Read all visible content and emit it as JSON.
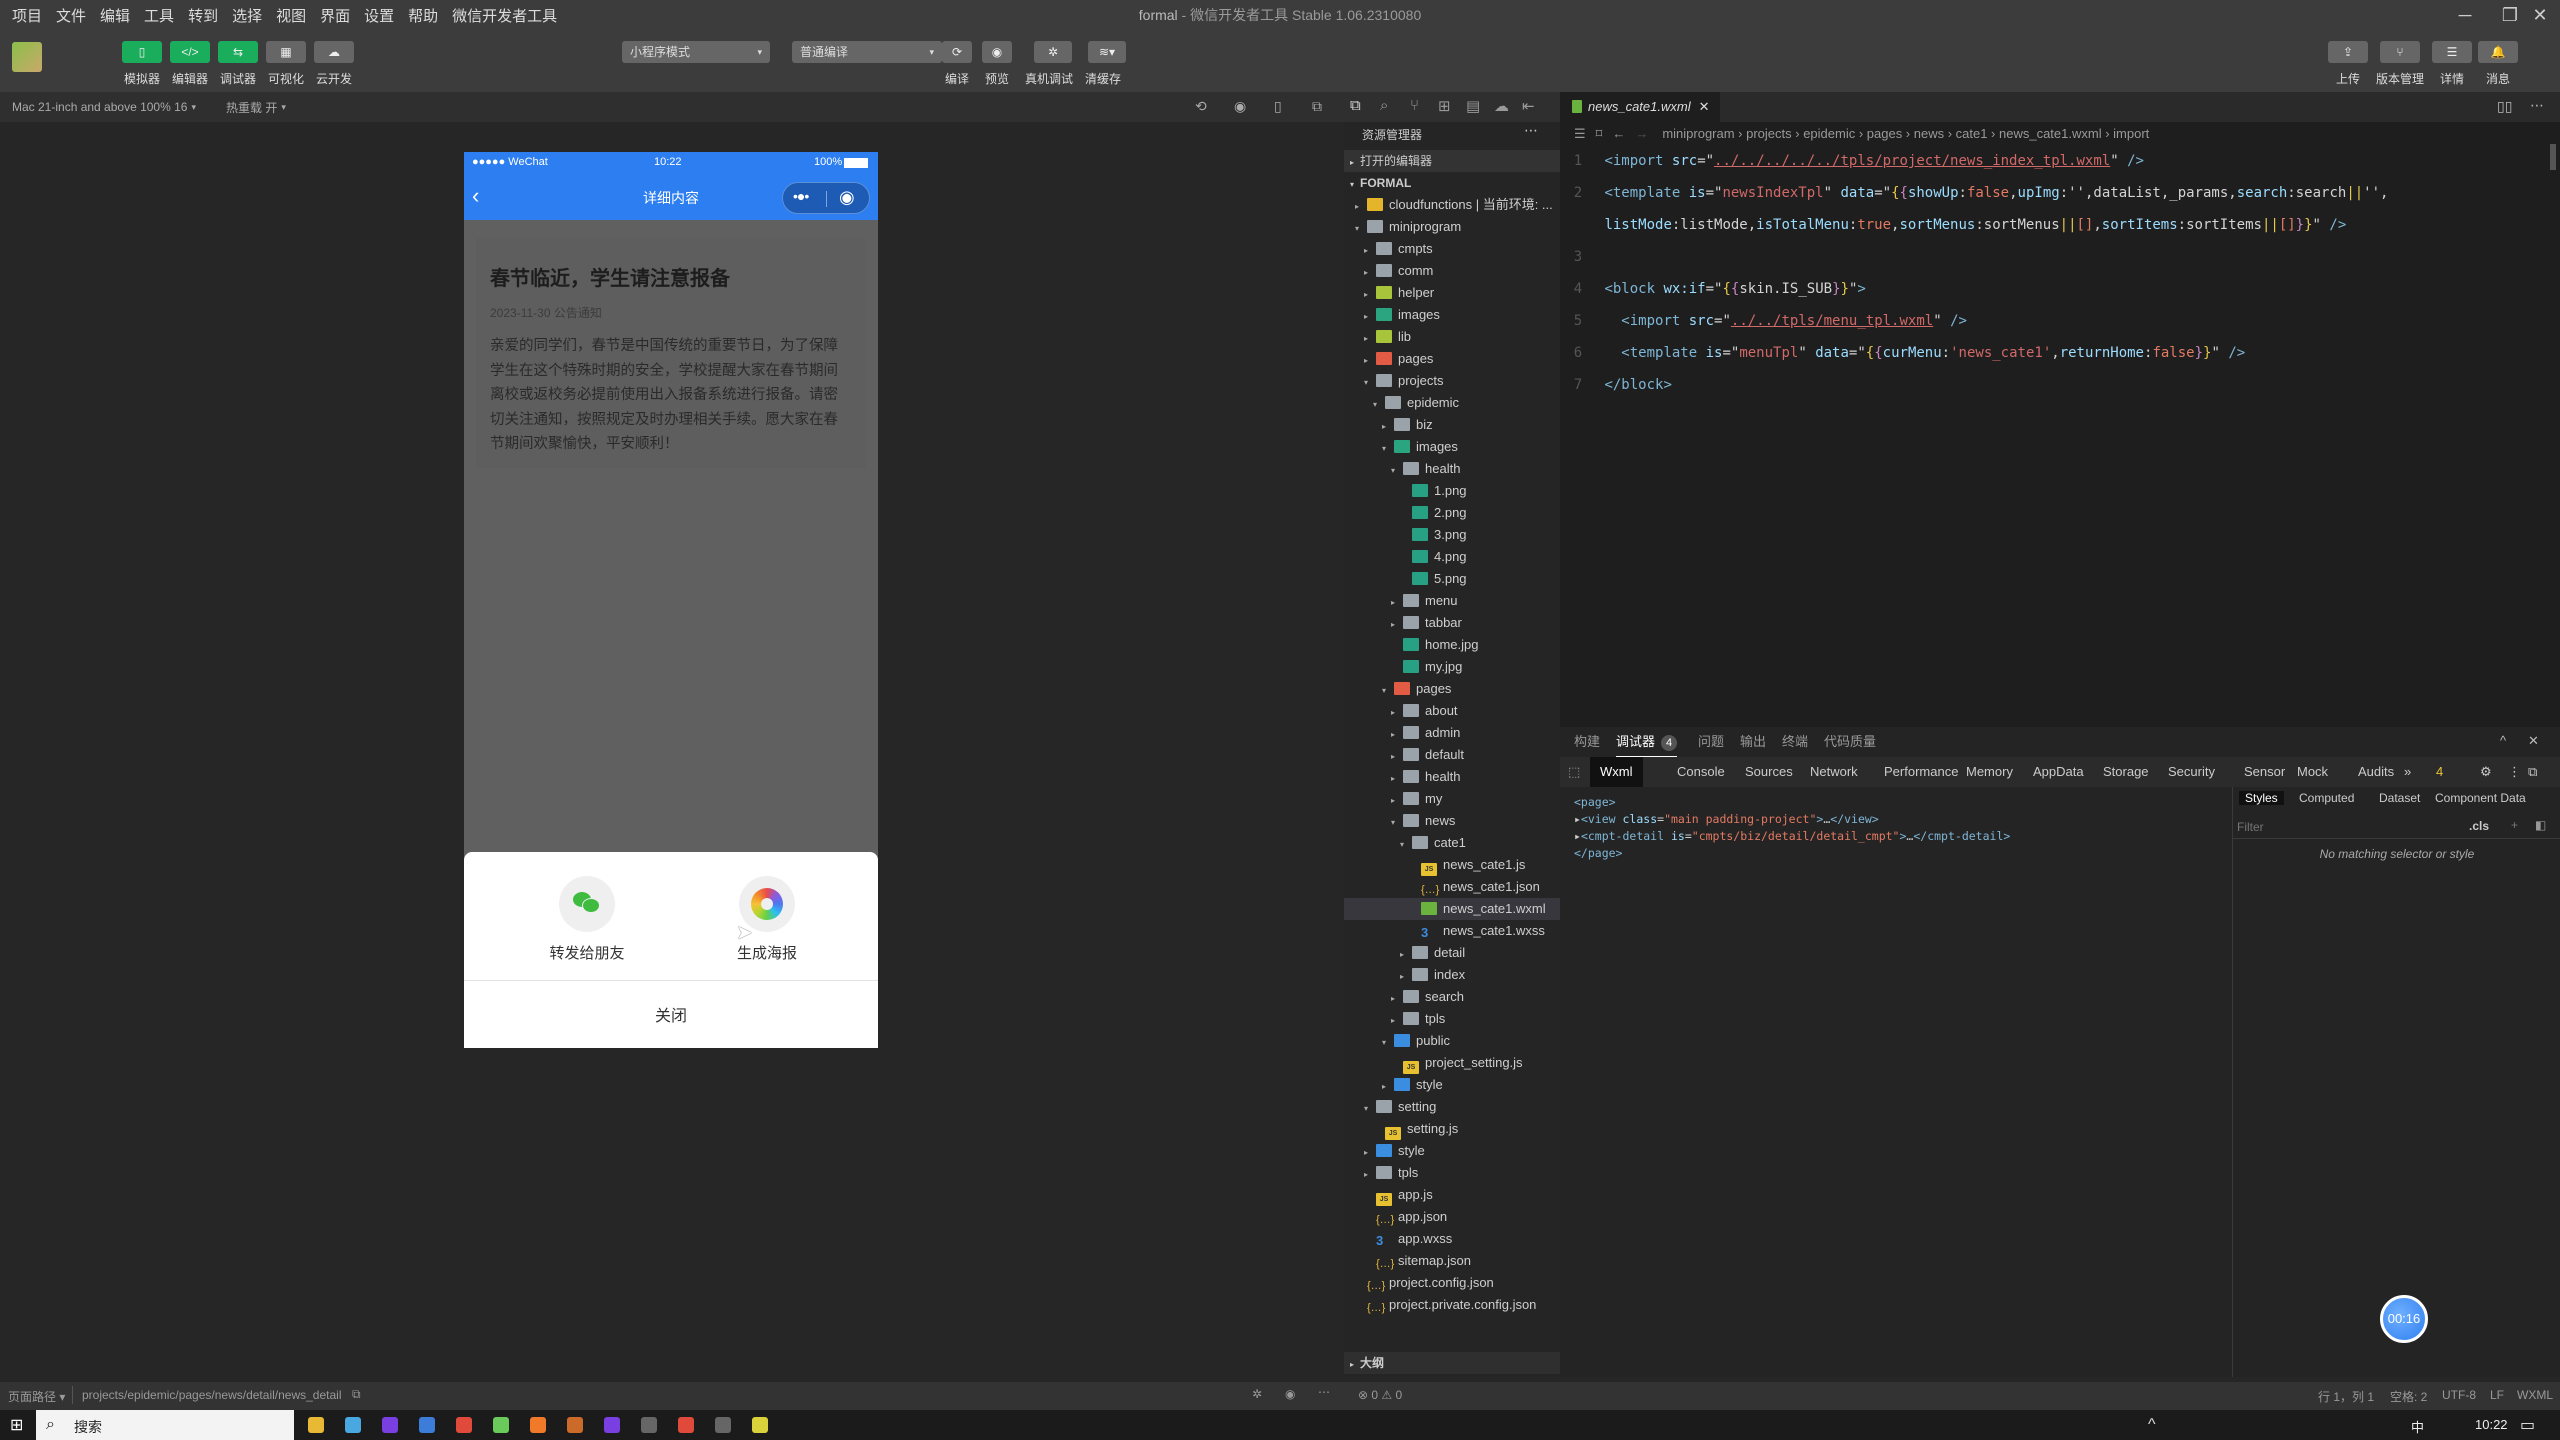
{
  "window": {
    "title_project": "formal",
    "title_rest": " - 微信开发者工具 Stable 1.06.2310080"
  },
  "menu": [
    "项目",
    "文件",
    "编辑",
    "工具",
    "转到",
    "选择",
    "视图",
    "界面",
    "设置",
    "帮助",
    "微信开发者工具"
  ],
  "toolbar": {
    "left_buttons": [
      {
        "label": "模拟器",
        "icon": "phone-icon",
        "glyph": "▯",
        "active": true
      },
      {
        "label": "编辑器",
        "icon": "code-icon",
        "glyph": "</>",
        "active": true
      },
      {
        "label": "调试器",
        "icon": "debug-toggle-icon",
        "glyph": "⇆",
        "active": true
      },
      {
        "label": "可视化",
        "icon": "layout-icon",
        "glyph": "▦",
        "active": false
      },
      {
        "label": "云开发",
        "icon": "cloud-icon",
        "glyph": "☁",
        "active": false
      }
    ],
    "mode_select": "小程序模式",
    "compile_select": "普通编译",
    "mid_buttons": [
      {
        "label": "编译",
        "icon": "refresh-icon",
        "glyph": "⟳"
      },
      {
        "label": "预览",
        "icon": "eye-icon",
        "glyph": "◉"
      },
      {
        "label": "真机调试",
        "icon": "bug-icon",
        "glyph": "✲"
      },
      {
        "label": "清缓存",
        "icon": "layers-icon",
        "glyph": "≋▾"
      }
    ],
    "right_buttons": [
      {
        "label": "上传",
        "icon": "upload-icon",
        "glyph": "⇪"
      },
      {
        "label": "版本管理",
        "icon": "branch-icon",
        "glyph": "⑂"
      },
      {
        "label": "详情",
        "icon": "menu-icon",
        "glyph": "☰"
      },
      {
        "label": "消息",
        "icon": "bell-icon",
        "glyph": "🔔"
      }
    ]
  },
  "simulator": {
    "device": "Mac 21-inch and above 100% 16",
    "hot_reload": "热重载 开",
    "status": {
      "carrier": "●●●●● WeChat",
      "time": "10:22",
      "battery": "100%"
    },
    "nav_title": "详细内容",
    "article": {
      "title": "春节临近，学生请注意报备",
      "meta": "2023-11-30 公告通知",
      "body": "亲爱的同学们，春节是中国传统的重要节日，为了保障学生在这个特殊时期的安全，学校提醒大家在春节期间离校或返校务必提前使用出入报备系统进行报备。请密切关注通知，按照规定及时办理相关手续。愿大家在春节期间欢聚愉快，平安顺利！"
    },
    "share_sheet": {
      "options": [
        {
          "label": "转发给朋友",
          "icon": "wechat-icon"
        },
        {
          "label": "生成海报",
          "icon": "poster-icon"
        }
      ],
      "close": "关闭"
    }
  },
  "explorer": {
    "title": "资源管理器",
    "open_editors": "打开的编辑器",
    "root": "FORMAL",
    "outline": "大纲",
    "tree": [
      {
        "d": 1,
        "arrow": "▸",
        "type": "folder f-yellow",
        "name": "cloudfunctions | 当前环境: ..."
      },
      {
        "d": 1,
        "arrow": "▾",
        "type": "folder",
        "name": "miniprogram"
      },
      {
        "d": 2,
        "arrow": "▸",
        "type": "folder",
        "name": "cmpts"
      },
      {
        "d": 2,
        "arrow": "▸",
        "type": "folder",
        "name": "comm"
      },
      {
        "d": 2,
        "arrow": "▸",
        "type": "f-lime",
        "name": "helper"
      },
      {
        "d": 2,
        "arrow": "▸",
        "type": "f-teal",
        "name": "images"
      },
      {
        "d": 2,
        "arrow": "▸",
        "type": "f-lime",
        "name": "lib"
      },
      {
        "d": 2,
        "arrow": "▸",
        "type": "f-red",
        "name": "pages"
      },
      {
        "d": 2,
        "arrow": "▾",
        "type": "folder",
        "name": "projects"
      },
      {
        "d": 3,
        "arrow": "▾",
        "type": "folder",
        "name": "epidemic"
      },
      {
        "d": 4,
        "arrow": "▸",
        "type": "folder",
        "name": "biz"
      },
      {
        "d": 4,
        "arrow": "▾",
        "type": "f-teal",
        "name": "images"
      },
      {
        "d": 5,
        "arrow": "▾",
        "type": "folder",
        "name": "health"
      },
      {
        "d": 6,
        "arrow": "",
        "type": "fimg",
        "name": "1.png"
      },
      {
        "d": 6,
        "arrow": "",
        "type": "fimg",
        "name": "2.png"
      },
      {
        "d": 6,
        "arrow": "",
        "type": "fimg",
        "name": "3.png"
      },
      {
        "d": 6,
        "arrow": "",
        "type": "fimg",
        "name": "4.png"
      },
      {
        "d": 6,
        "arrow": "",
        "type": "fimg",
        "name": "5.png"
      },
      {
        "d": 5,
        "arrow": "▸",
        "type": "folder",
        "name": "menu"
      },
      {
        "d": 5,
        "arrow": "▸",
        "type": "folder",
        "name": "tabbar"
      },
      {
        "d": 5,
        "arrow": "",
        "type": "fimg",
        "name": "home.jpg"
      },
      {
        "d": 5,
        "arrow": "",
        "type": "fimg",
        "name": "my.jpg"
      },
      {
        "d": 4,
        "arrow": "▾",
        "type": "f-red",
        "name": "pages"
      },
      {
        "d": 5,
        "arrow": "▸",
        "type": "folder",
        "name": "about"
      },
      {
        "d": 5,
        "arrow": "▸",
        "type": "folder",
        "name": "admin"
      },
      {
        "d": 5,
        "arrow": "▸",
        "type": "folder",
        "name": "default"
      },
      {
        "d": 5,
        "arrow": "▸",
        "type": "folder",
        "name": "health"
      },
      {
        "d": 5,
        "arrow": "▸",
        "type": "folder",
        "name": "my"
      },
      {
        "d": 5,
        "arrow": "▾",
        "type": "folder",
        "name": "news"
      },
      {
        "d": 6,
        "arrow": "▾",
        "type": "folder",
        "name": "cate1"
      },
      {
        "d": 7,
        "arrow": "",
        "type": "fjs",
        "name": "news_cate1.js"
      },
      {
        "d": 7,
        "arrow": "",
        "type": "fjson",
        "name": "news_cate1.json"
      },
      {
        "d": 7,
        "arrow": "",
        "type": "fwx",
        "name": "news_cate1.wxml",
        "selected": true
      },
      {
        "d": 7,
        "arrow": "",
        "type": "fcss",
        "name": "news_cate1.wxss"
      },
      {
        "d": 6,
        "arrow": "▸",
        "type": "folder",
        "name": "detail"
      },
      {
        "d": 6,
        "arrow": "▸",
        "type": "folder",
        "name": "index"
      },
      {
        "d": 5,
        "arrow": "▸",
        "type": "folder",
        "name": "search"
      },
      {
        "d": 5,
        "arrow": "▸",
        "type": "folder",
        "name": "tpls"
      },
      {
        "d": 4,
        "arrow": "▾",
        "type": "f-blue",
        "name": "public"
      },
      {
        "d": 5,
        "arrow": "",
        "type": "fjs",
        "name": "project_setting.js"
      },
      {
        "d": 4,
        "arrow": "▸",
        "type": "f-blue",
        "name": "style"
      },
      {
        "d": 2,
        "arrow": "▾",
        "type": "folder",
        "name": "setting"
      },
      {
        "d": 3,
        "arrow": "",
        "type": "fjs",
        "name": "setting.js"
      },
      {
        "d": 2,
        "arrow": "▸",
        "type": "f-blue",
        "name": "style"
      },
      {
        "d": 2,
        "arrow": "▸",
        "type": "folder",
        "name": "tpls"
      },
      {
        "d": 2,
        "arrow": "",
        "type": "fjs",
        "name": "app.js"
      },
      {
        "d": 2,
        "arrow": "",
        "type": "fjson",
        "name": "app.json"
      },
      {
        "d": 2,
        "arrow": "",
        "type": "fcss",
        "name": "app.wxss"
      },
      {
        "d": 2,
        "arrow": "",
        "type": "fjson",
        "name": "sitemap.json"
      },
      {
        "d": 1,
        "arrow": "",
        "type": "fjson",
        "name": "project.config.json"
      },
      {
        "d": 1,
        "arrow": "",
        "type": "fjson",
        "name": "project.private.config.json"
      }
    ],
    "problems": "⊗ 0 ⚠ 0"
  },
  "editor": {
    "tab": "news_cate1.wxml",
    "breadcrumb": "miniprogram › projects › epidemic › pages › news › cate1 › news_cate1.wxml › import",
    "lines": [
      {
        "n": "1",
        "html": "<span class='tg'>&lt;import</span> <span class='at'>src</span><span class='pl'>=\"</span><span class='st' style='text-decoration:underline'>../../../../../tpls/project/news_index_tpl.wxml</span><span class='pl'>\"</span> <span class='tg'>/&gt;</span>"
      },
      {
        "n": "2",
        "html": "<span class='tg'>&lt;template</span> <span class='at'>is</span><span class='pl'>=\"</span><span class='st'>newsIndexTpl</span><span class='pl'>\"</span> <span class='at'>data</span><span class='pl'>=\"</span><span class='br'>{</span><span class='pk'>{</span><span class='at'>showUp</span><span class='pl'>:</span><span class='kw'>false</span><span class='pl'>,</span><span class='at'>upImg</span><span class='pl'>:'',dataList,_params,</span><span class='at'>search</span><span class='pl'>:search</span><span class='br'>||</span><span class='pl'>'',</span>"
      },
      {
        "n": "",
        "html": "<span class='at'>listMode</span><span class='pl'>:listMode,</span><span class='at'>isTotalMenu</span><span class='pl'>:</span><span class='kw'>true</span><span class='pl'>,</span><span class='at'>sortMenus</span><span class='pl'>:sortMenus</span><span class='br'>||</span><span class='kw'>[]</span><span class='pl'>,</span><span class='at'>sortItems</span><span class='pl'>:sortItems</span><span class='br'>||</span><span class='kw'>[]</span><span class='pk'>}</span><span class='br'>}</span><span class='pl'>\"</span> <span class='tg'>/&gt;</span>"
      },
      {
        "n": "3",
        "html": ""
      },
      {
        "n": "4",
        "html": "<span class='tg'>&lt;block</span> <span class='at'>wx:if</span><span class='pl'>=\"</span><span class='br'>{</span><span class='pk'>{</span><span class='pl'>skin.IS_SUB</span><span class='pk'>}</span><span class='br'>}</span><span class='pl'>\"</span><span class='tg'>&gt;</span>"
      },
      {
        "n": "5",
        "html": "  <span class='tg'>&lt;import</span> <span class='at'>src</span><span class='pl'>=\"</span><span class='st' style='text-decoration:underline'>../../tpls/menu_tpl.wxml</span><span class='pl'>\"</span> <span class='tg'>/&gt;</span>"
      },
      {
        "n": "6",
        "html": "  <span class='tg'>&lt;template</span> <span class='at'>is</span><span class='pl'>=\"</span><span class='st'>menuTpl</span><span class='pl'>\"</span> <span class='at'>data</span><span class='pl'>=\"</span><span class='br'>{</span><span class='pk'>{</span><span class='at'>curMenu</span><span class='pl'>:</span><span class='st'>'news_cate1'</span><span class='pl'>,</span><span class='at'>returnHome</span><span class='pl'>:</span><span class='kw'>false</span><span class='pk'>}</span><span class='br'>}</span><span class='pl'>\"</span> <span class='tg'>/&gt;</span>"
      },
      {
        "n": "7",
        "html": "<span class='tg'>&lt;/block&gt;</span>"
      }
    ]
  },
  "devtools": {
    "panel_tabs": [
      {
        "label": "构建"
      },
      {
        "label": "调试器",
        "badge": "4",
        "active": true
      },
      {
        "label": "问题"
      },
      {
        "label": "输出"
      },
      {
        "label": "终端"
      },
      {
        "label": "代码质量"
      }
    ],
    "tabs": [
      "Wxml",
      "Console",
      "Sources",
      "Network",
      "Performance",
      "Memory",
      "AppData",
      "Storage",
      "Security",
      "Sensor",
      "Mock",
      "Audits"
    ],
    "more": "»",
    "warnings": "4",
    "dom": [
      {
        "html": "<span class='tg'>&lt;page&gt;</span>"
      },
      {
        "html": "▸<span class='tg'>&lt;view</span> <span class='at'>class</span>=<span class='kw'>\"main padding-project\"</span><span class='tg'>&gt;</span>…<span class='tg'>&lt;/view&gt;</span>"
      },
      {
        "html": "▸<span class='tg'>&lt;cmpt-detail</span> <span class='at'>is</span>=<span class='kw'>\"cmpts/biz/detail/detail_cmpt\"</span><span class='tg'>&gt;</span>…<span class='tg'>&lt;/cmpt-detail&gt;</span>"
      },
      {
        "html": "<span class='tg'>&lt;/page&gt;</span>"
      }
    ],
    "style_tabs": [
      "Styles",
      "Computed",
      "Dataset",
      "Component Data"
    ],
    "filter_placeholder": "Filter",
    "cls": ".cls",
    "no_match": "No matching selector or style"
  },
  "statusbar": {
    "path_label": "页面路径 ▾",
    "path": "projects/epidemic/pages/news/detail/news_detail",
    "position": "行 1，列 1",
    "spaces": "空格: 2",
    "encoding": "UTF-8",
    "eol": "LF",
    "lang": "WXML"
  },
  "taskbar": {
    "search": "搜索",
    "time": "10:22",
    "ime": "中"
  },
  "timer": "00:16"
}
